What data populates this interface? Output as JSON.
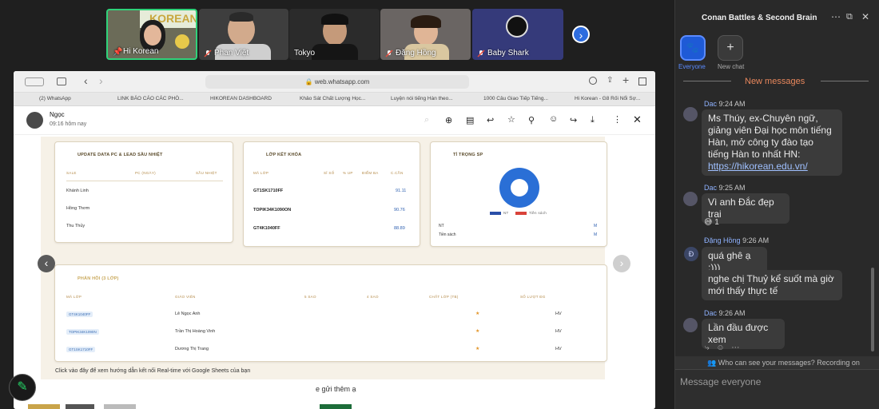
{
  "participants": [
    {
      "name": "Hi Korean",
      "logo": "KOREAN",
      "muted": false
    },
    {
      "name": "Phan Việt",
      "muted": true
    },
    {
      "name": "Tokyo",
      "muted": false
    },
    {
      "name": "Đặng Hồng",
      "muted": true
    },
    {
      "name": "Baby Shark",
      "muted": true
    }
  ],
  "browser": {
    "url": "web.whatsapp.com"
  },
  "tabs": [
    "(2) WhatsApp",
    "LINK BÁO CÁO CÁC PHÒ...",
    "HIKOREAN DASHBOARD",
    "Khảo Sát Chất Lượng Học...",
    "Luyện nói tiếng Hàn theo...",
    "1000 Câu Giao Tiếp Tiếng...",
    "Hi Korean - G8 Rối Nổi Sợ..."
  ],
  "whatsapp": {
    "contact": "Ngọc",
    "time": "09:16 hôm nay",
    "caption": "e gửi thêm ạ"
  },
  "dashboard": {
    "card1": {
      "title": "UPDATE DATA PC & LEAD SẦU NHIỆT",
      "headers": [
        "SALE",
        "PC (NGÀY)",
        "SẦU NHIỆT"
      ],
      "rows": [
        "Khánh Linh",
        "Hồng Thơm",
        "Thu Thủy"
      ]
    },
    "card2": {
      "title": "LỚP KẾT KHÓA",
      "headers": [
        "MÃ LỚP",
        "SĨ SỐ",
        "% UP",
        "ĐIỂM BA",
        "C.CẦN"
      ],
      "rows": [
        {
          "code": "GT1SK1710FF",
          "value": "91.11"
        },
        {
          "code": "TOPIK34K1090ON",
          "value": "90.76"
        },
        {
          "code": "GT4K1040FF",
          "value": "88.89"
        }
      ]
    },
    "card3": {
      "title": "TỈ TRỌNG SP",
      "legend": [
        "NT",
        "Tiền sách"
      ],
      "rows": [
        {
          "label": "NT",
          "value": "M"
        },
        {
          "label": "Tiền sách",
          "value": "M"
        }
      ]
    },
    "card4": {
      "title": "PHẢN HỒI (3 LỚP)",
      "headers": [
        "MÃ LỚP",
        "GIÁO VIÊN",
        "5 SAO",
        "4 SAO",
        "CHẤT LỚP (TB)",
        "SỐ LƯỢT ĐG"
      ],
      "rows": [
        {
          "code": "GT4K1040FF",
          "teacher": "Lê Ngọc Anh",
          "unit": "HV"
        },
        {
          "code": "TOPIK34K1090N",
          "teacher": "Trần Thị Hoàng Vinh",
          "unit": "HV"
        },
        {
          "code": "GT1SK1710FF",
          "teacher": "Dương Thị Trang",
          "unit": "HV"
        }
      ]
    },
    "footer": "Click vào đây để xem hướng dẫn kết nối Real-time với Google Sheets của bạn"
  },
  "chat": {
    "title": "Conan Battles & Second Brain",
    "tabs": [
      {
        "label": "Everyone"
      },
      {
        "label": "New chat"
      }
    ],
    "new_messages": "New messages",
    "messages": [
      {
        "sender": "Dac",
        "time": "9:24 AM",
        "text": "Ms Thúy, ex-Chuyên ngữ, giảng viên Đại học môn tiếng Hàn, mở công ty đào tạo tiếng Hàn to nhất HN:",
        "link": "https://hikorean.edu.vn/"
      },
      {
        "sender": "Dac",
        "time": "9:25 AM",
        "text": "Vì anh Đắc đẹp trai",
        "reaction": "😅",
        "reaction_count": "1"
      },
      {
        "sender": "Đặng Hồng",
        "time": "9:26 AM",
        "initial": "Đ",
        "text": "quá ghê ạ :)))",
        "text2": "nghe chị Thuỷ kể suốt mà giờ mới thấy thực tế"
      },
      {
        "sender": "Dac",
        "time": "9:26 AM",
        "text": "Lần đầu được xem"
      }
    ],
    "notice": "Who can see your messages? Recording on",
    "input_placeholder": "Message everyone"
  },
  "colors": {
    "accent": "#2d6cdf",
    "chip": "#3c6fb5",
    "pie": "#2a6fd6",
    "legend2": "#d9433a"
  }
}
